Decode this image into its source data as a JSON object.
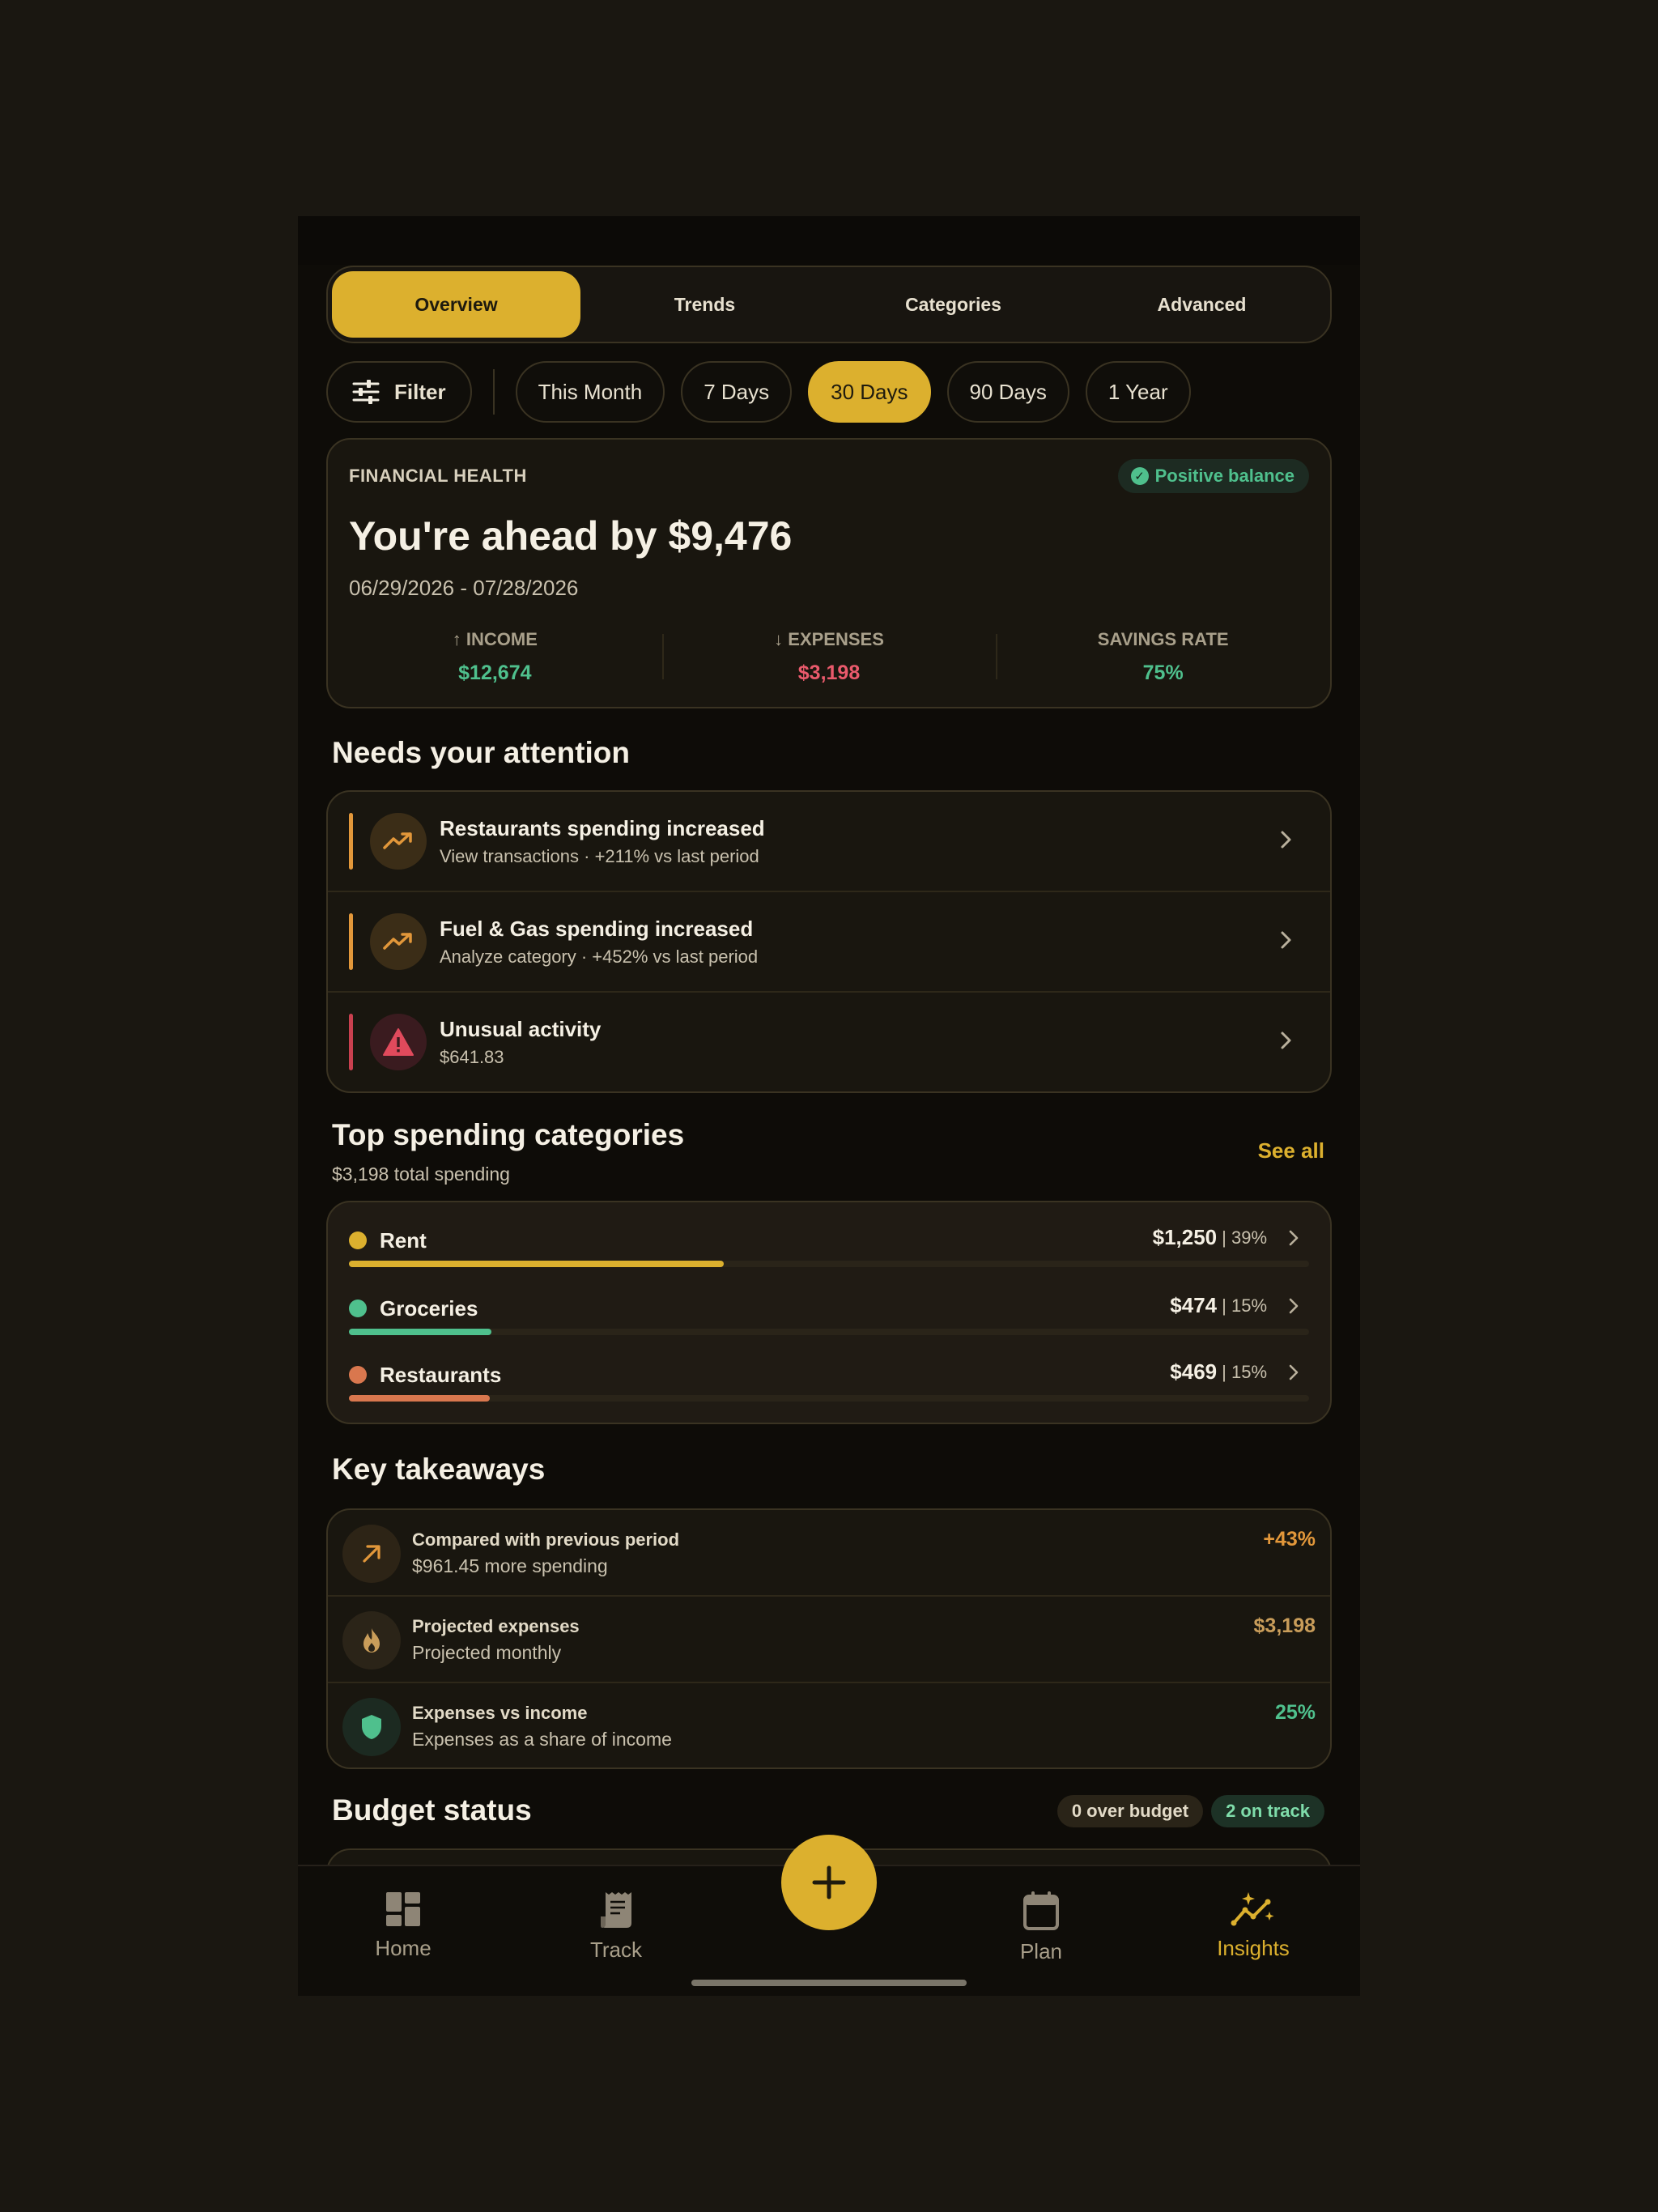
{
  "tabs": [
    {
      "label": "Overview",
      "active": true
    },
    {
      "label": "Trends",
      "active": false
    },
    {
      "label": "Categories",
      "active": false
    },
    {
      "label": "Advanced",
      "active": false
    }
  ],
  "filter": {
    "label": "Filter"
  },
  "ranges": [
    {
      "label": "This Month",
      "active": false
    },
    {
      "label": "7 Days",
      "active": false
    },
    {
      "label": "30 Days",
      "active": true
    },
    {
      "label": "90 Days",
      "active": false
    },
    {
      "label": "1 Year",
      "active": false
    }
  ],
  "financial_health": {
    "label": "FINANCIAL HEALTH",
    "badge": "Positive balance",
    "headline": "You're ahead by $9,476",
    "date_range": "06/29/2026 - 07/28/2026",
    "income_label": "INCOME",
    "income_value": "$12,674",
    "expenses_label": "EXPENSES",
    "expenses_value": "$3,198",
    "savings_label": "SAVINGS RATE",
    "savings_value": "75%"
  },
  "attention": {
    "title": "Needs your attention",
    "items": [
      {
        "title": "Restaurants spending increased",
        "subtitle": "View transactions · +211% vs last period",
        "icon": "trending-up-icon",
        "color": "#e2973a"
      },
      {
        "title": "Fuel & Gas spending increased",
        "subtitle": "Analyze category · +452% vs last period",
        "icon": "trending-up-icon",
        "color": "#e2973a"
      },
      {
        "title": "Unusual activity",
        "subtitle": "$641.83",
        "icon": "warning-icon",
        "color": "#e04a5c"
      }
    ]
  },
  "top_categories": {
    "title": "Top spending categories",
    "subtitle": "$3,198 total spending",
    "see_all": "See all",
    "items": [
      {
        "name": "Rent",
        "amount": "$1,250",
        "percent": "| 39%",
        "share": 0.39,
        "color": "#dcb02e"
      },
      {
        "name": "Groceries",
        "amount": "$474",
        "percent": "| 15%",
        "share": 0.148,
        "color": "#4fc08d"
      },
      {
        "name": "Restaurants",
        "amount": "$469",
        "percent": "| 15%",
        "share": 0.147,
        "color": "#d9774e"
      }
    ]
  },
  "takeaways": {
    "title": "Key takeaways",
    "items": [
      {
        "title": "Compared with previous period",
        "subtitle": "$961.45 more spending",
        "value": "+43%",
        "icon": "arrow-up-right-icon",
        "color": "#e2973a"
      },
      {
        "title": "Projected expenses",
        "subtitle": "Projected monthly",
        "value": "$3,198",
        "icon": "flame-icon",
        "color": "#c99d5a"
      },
      {
        "title": "Expenses vs income",
        "subtitle": "Expenses as a share of income",
        "value": "25%",
        "icon": "shield-icon",
        "color": "#4fc08d"
      }
    ]
  },
  "budget": {
    "title": "Budget status",
    "over": "0 over budget",
    "on_track": "2 on track"
  },
  "nav": {
    "home": "Home",
    "track": "Track",
    "plan": "Plan",
    "insights": "Insights",
    "active": "insights"
  },
  "colors": {
    "accent": "#dcb02e",
    "positive": "#4fc08d",
    "negative": "#ea5a6c",
    "background": "#0e0c08"
  }
}
